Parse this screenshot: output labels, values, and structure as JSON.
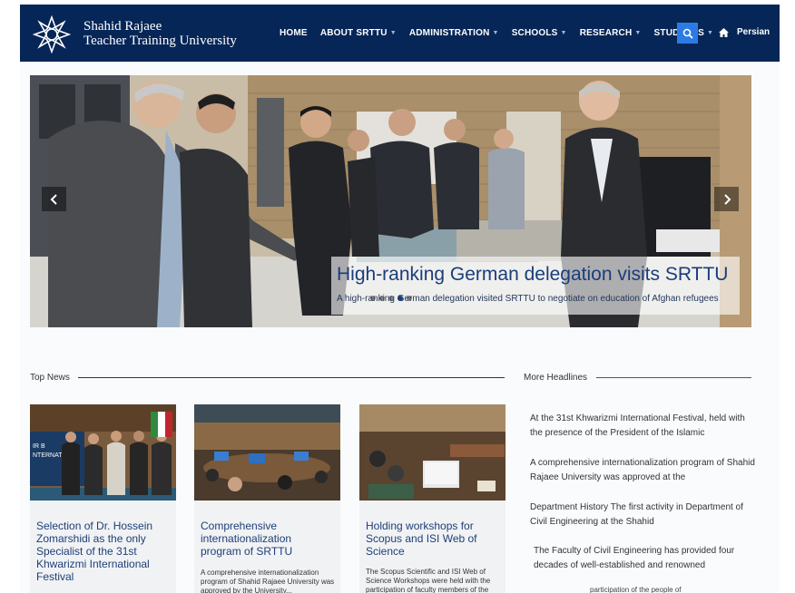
{
  "header": {
    "brand_line1": "Shahid Rajaee",
    "brand_line2": "Teacher Training University",
    "nav": [
      {
        "label": "HOME",
        "has_dropdown": false
      },
      {
        "label": "ABOUT SRTTU",
        "has_dropdown": true
      },
      {
        "label": "ADMINISTRATION",
        "has_dropdown": true
      },
      {
        "label": "SCHOOLS",
        "has_dropdown": true
      },
      {
        "label": "RESEARCH",
        "has_dropdown": true
      },
      {
        "label": "STUDENTS",
        "has_dropdown": true
      }
    ],
    "search_icon": "search-icon",
    "language_label": "Persian",
    "language_icon": "home-icon"
  },
  "slider": {
    "title": "High-ranking German delegation visits SRTTU",
    "text": "A high-ranking German delegation visited SRTTU to negotiate on education of Afghan refugees",
    "prev_icon": "chevron-left-icon",
    "next_icon": "chevron-right-icon",
    "dot_count": 5,
    "active_dot": 3
  },
  "top_news": {
    "title": "Top News",
    "cards": [
      {
        "title": "Selection of Dr. Hossein Zomarshidi as the only Specialist of the 31st Khwarizmi International Festival",
        "desc": ""
      },
      {
        "title": "Comprehensive internationalization program of SRTTU",
        "desc": "A comprehensive internationalization program of Shahid Rajaee University was approved by the University..."
      },
      {
        "title": "Holding workshops for Scopus and ISI Web of Science",
        "desc": "The Scopus Scientific and ISI Web of Science Workshops were held with the participation of faculty members of the university..."
      }
    ]
  },
  "more_headlines": {
    "title": "More Headlines",
    "items": [
      "At the 31st Khwarizmi International Festival, held with the presence of the President of the Islamic",
      "A comprehensive internationalization program of Shahid Rajaee University was approved at the",
      "Department History The first activity in Department of Civil Engineering at the Shahid",
      "The Faculty of Civil Engineering has provided four decades of well-established and renowned"
    ],
    "cut_off_text": "participation of the people of"
  },
  "colors": {
    "header_bg": "#062657",
    "accent_blue": "#2c7be5",
    "link_blue": "#1d3f78",
    "caption_title": "#1a3d7c"
  }
}
